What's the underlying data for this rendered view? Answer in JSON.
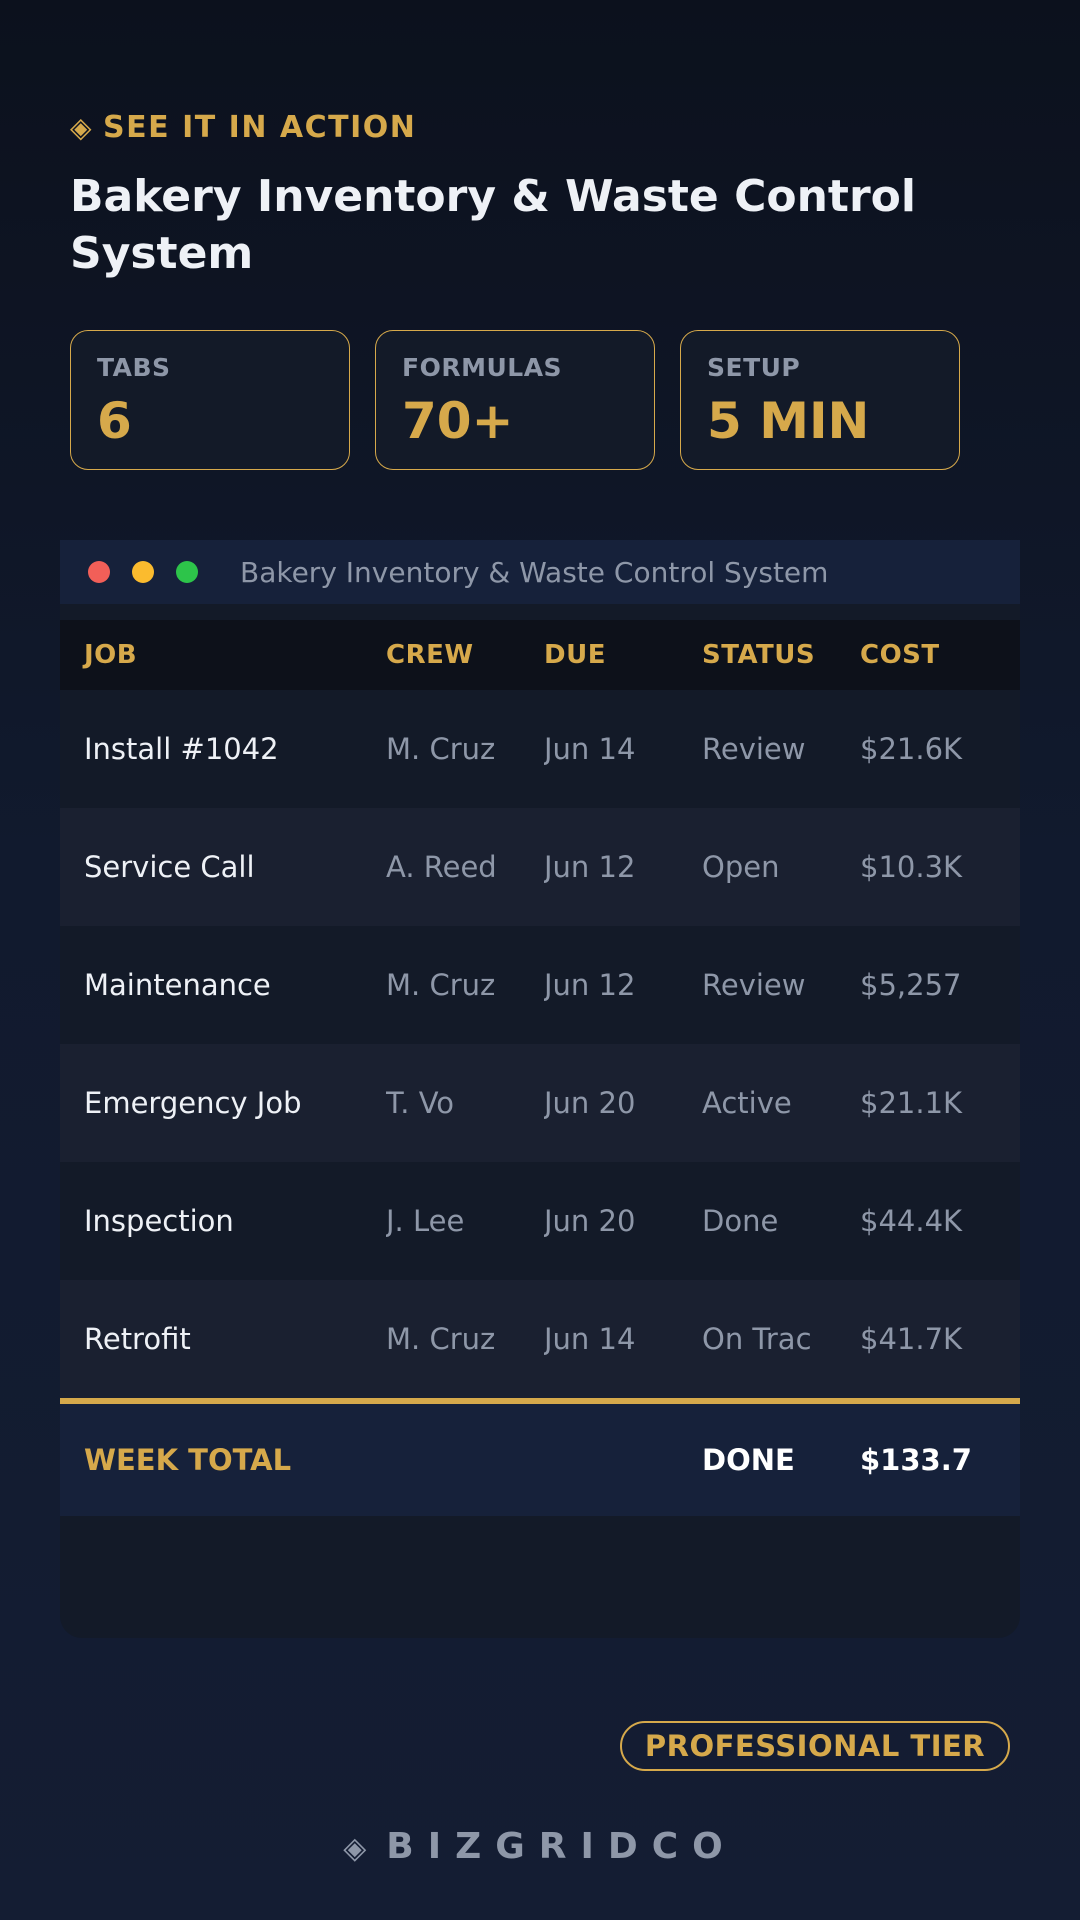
{
  "header": {
    "eyebrow_icon": "◈",
    "eyebrow": "SEE IT IN ACTION",
    "title": "Bakery Inventory & Waste Control System"
  },
  "stats": [
    {
      "label": "TABS",
      "value": "6"
    },
    {
      "label": "FORMULAS",
      "value": "70+"
    },
    {
      "label": "SETUP",
      "value": "5 MIN"
    }
  ],
  "window": {
    "title": "Bakery Inventory & Waste Control System"
  },
  "table": {
    "columns": [
      "JOB",
      "CREW",
      "DUE",
      "STATUS",
      "COST"
    ],
    "rows": [
      [
        "Install #1042",
        "M. Cruz",
        "Jun 14",
        "Review",
        "$21.6K"
      ],
      [
        "Service Call",
        "A. Reed",
        "Jun 12",
        "Open",
        "$10.3K"
      ],
      [
        "Maintenance",
        "M. Cruz",
        "Jun 12",
        "Review",
        "$5,257"
      ],
      [
        "Emergency Job",
        "T. Vo",
        "Jun 20",
        "Active",
        "$21.1K"
      ],
      [
        "Inspection",
        "J. Lee",
        "Jun 20",
        "Done",
        "$44.4K"
      ],
      [
        "Retrofit",
        "M. Cruz",
        "Jun 14",
        "On Trac",
        "$41.7K"
      ]
    ],
    "total": {
      "label": "WEEK TOTAL",
      "status": "DONE",
      "cost": "$133.7"
    }
  },
  "tier": "PROFESSIONAL TIER",
  "brand": {
    "icon": "◈",
    "name": "BIZGRIDCO"
  },
  "colors": {
    "accent": "#d6a94b",
    "background": "#0c111d",
    "muted": "#8e97a8"
  }
}
